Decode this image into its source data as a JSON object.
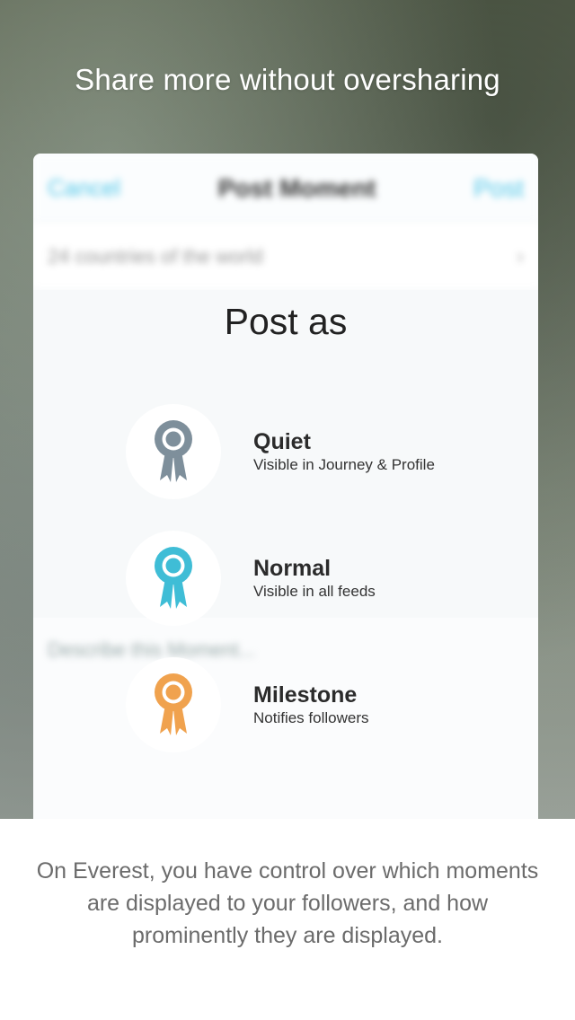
{
  "headline": "Share more without oversharing",
  "background_screen": {
    "nav": {
      "cancel_label": "Cancel",
      "title": "Post Moment",
      "post_label": "Post"
    },
    "location_row": {
      "text": "24 countries of the world",
      "chevron": "chevron-right-icon"
    },
    "description_placeholder": "Describe this Moment..."
  },
  "sheet": {
    "title": "Post as",
    "options": [
      {
        "title": "Quiet",
        "subtitle": "Visible in Journey & Profile",
        "icon": "ribbon-award-icon",
        "color": "#7e8f9b"
      },
      {
        "title": "Normal",
        "subtitle": "Visible in all feeds",
        "icon": "ribbon-award-icon",
        "color": "#3fbdd6"
      },
      {
        "title": "Milestone",
        "subtitle": "Notifies followers",
        "icon": "ribbon-award-icon",
        "color": "#f0a24e"
      }
    ]
  },
  "footer": {
    "text": "On Everest, you have control over which moments are displayed to your followers, and how prominently they are displayed."
  }
}
